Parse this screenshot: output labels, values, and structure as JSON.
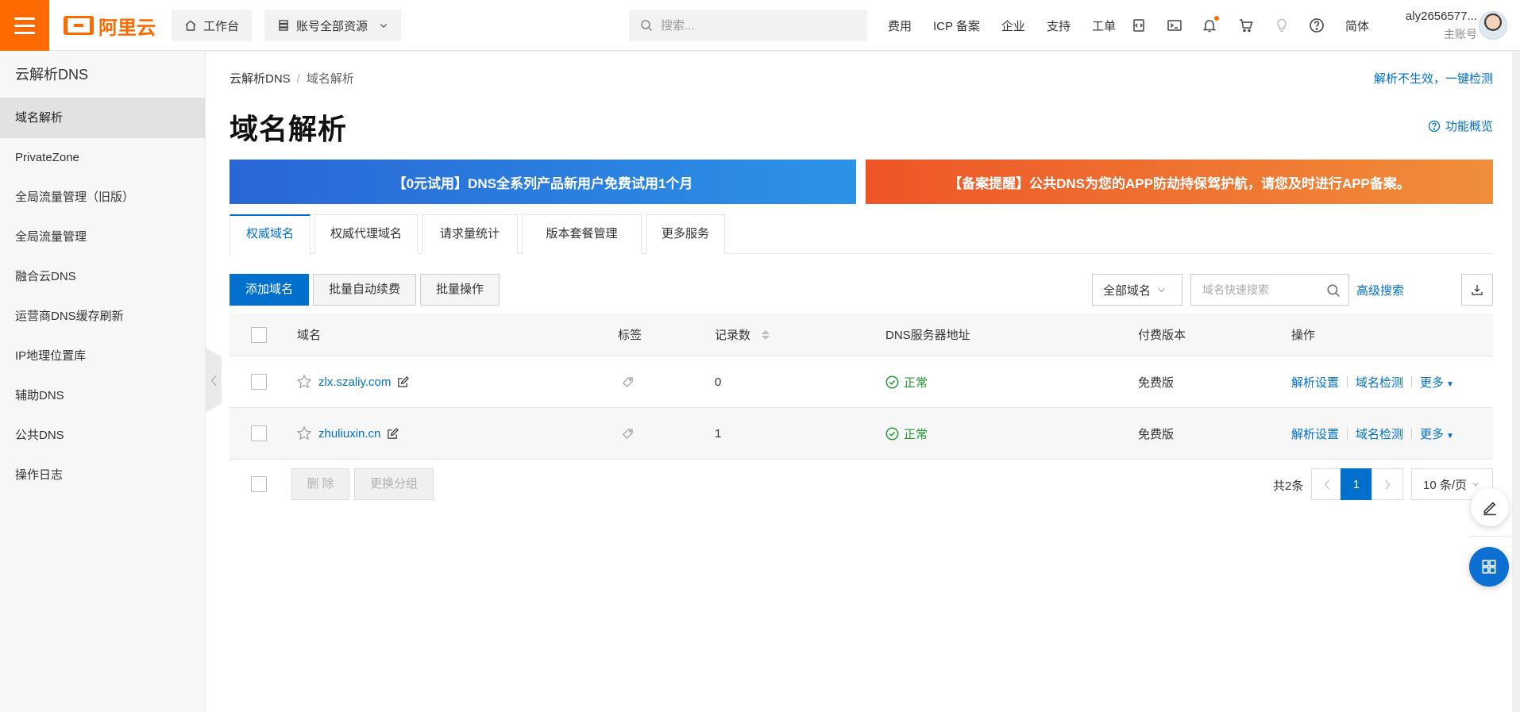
{
  "topbar": {
    "brand": "阿里云",
    "workbench": "工作台",
    "resources": "账号全部资源",
    "search_placeholder": "搜索...",
    "links": [
      "费用",
      "ICP 备案",
      "企业",
      "支持",
      "工单"
    ],
    "lang": "简体",
    "account_name": "aly2656577...",
    "account_role": "主账号",
    "accent_color": "#ff6a00"
  },
  "sidebar": {
    "title": "云解析DNS",
    "items": [
      {
        "label": "域名解析",
        "active": true
      },
      {
        "label": "PrivateZone"
      },
      {
        "label": "全局流量管理（旧版）"
      },
      {
        "label": "全局流量管理"
      },
      {
        "label": "融合云DNS"
      },
      {
        "label": "运营商DNS缓存刷新"
      },
      {
        "label": "IP地理位置库"
      },
      {
        "label": "辅助DNS"
      },
      {
        "label": "公共DNS"
      },
      {
        "label": "操作日志"
      }
    ]
  },
  "main": {
    "breadcrumb": [
      "云解析DNS",
      "/",
      "域名解析"
    ],
    "diag_link": "解析不生效，一键检测",
    "title": "域名解析",
    "overview_link": "功能概览",
    "banner_left": "【0元试用】DNS全系列产品新用户免费试用1个月",
    "banner_right": "【备案提醒】公共DNS为您的APP防劫持保驾护航，请您及时进行APP备案。",
    "tabs": [
      "权威域名",
      "权威代理域名",
      "请求量统计",
      "版本套餐管理",
      "更多服务"
    ],
    "toolbar": {
      "add": "添加域名",
      "auto_renew": "批量自动续费",
      "batch": "批量操作",
      "filter": "全部域名",
      "search_placeholder": "域名快速搜索",
      "advanced": "高级搜索"
    },
    "table": {
      "headers": [
        "域名",
        "标签",
        "记录数",
        "DNS服务器地址",
        "付费版本",
        "操作"
      ],
      "rows": [
        {
          "domain": "zlx.szaliy.com",
          "records": "0",
          "status": "正常",
          "edition": "免费版"
        },
        {
          "domain": "zhuliuxin.cn",
          "records": "1",
          "status": "正常",
          "edition": "免费版"
        }
      ],
      "ops": [
        "解析设置",
        "域名检测",
        "更多"
      ]
    },
    "footer": {
      "delete": "删 除",
      "change_group": "更换分组",
      "total": "共2条",
      "current_page": "1",
      "page_size": "10 条/页"
    }
  }
}
